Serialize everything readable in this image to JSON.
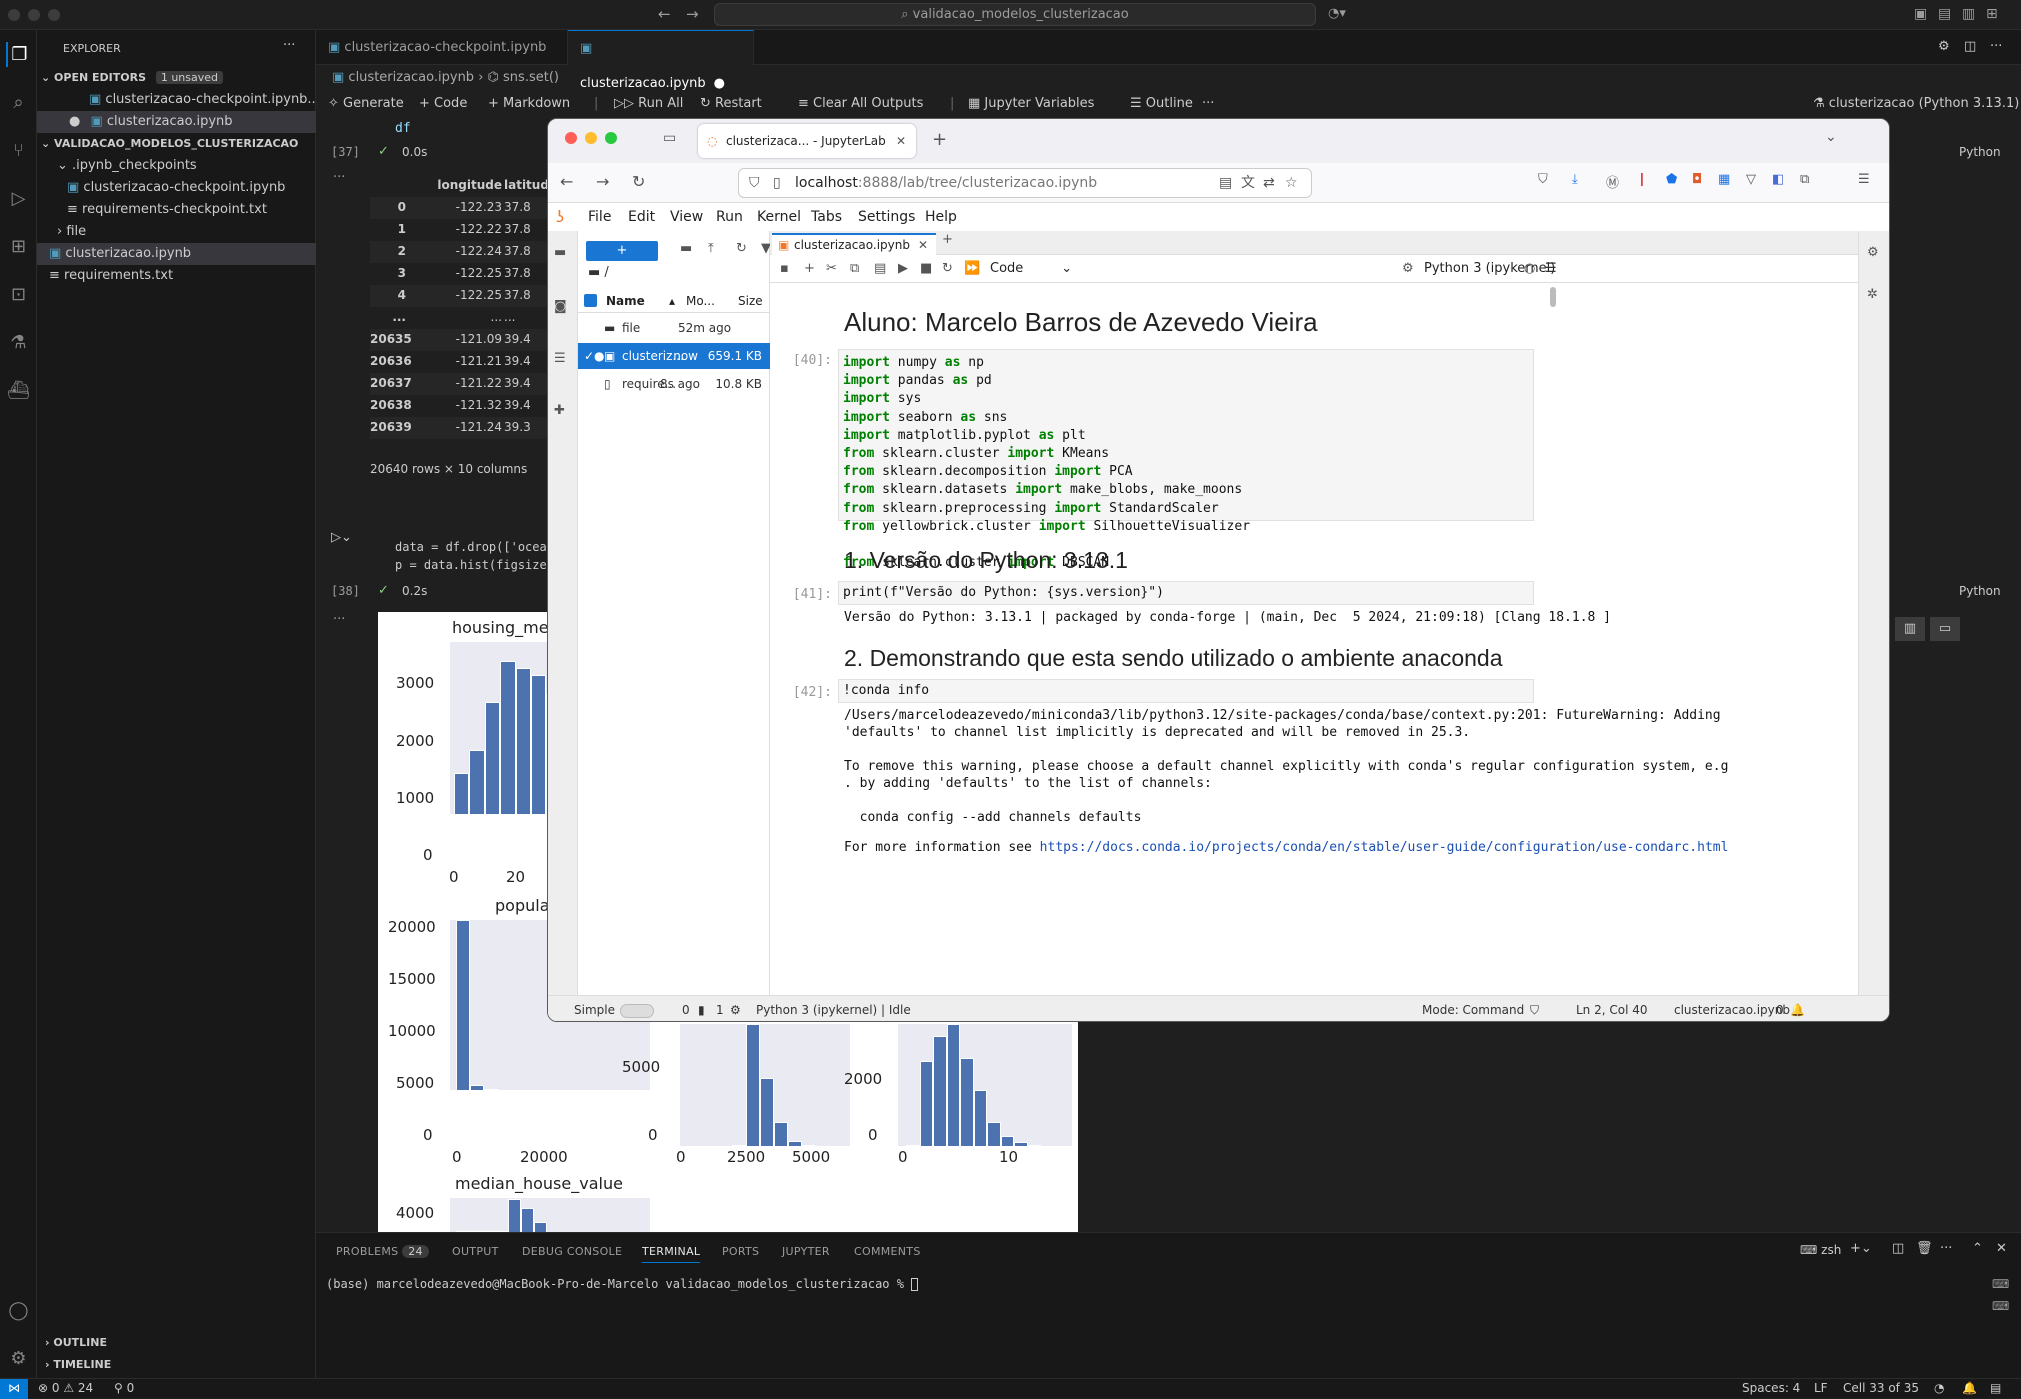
{
  "vscode": {
    "search_text": "validacao_modelos_clusterizacao",
    "explorer_label": "EXPLORER",
    "open_editors_label": "OPEN EDITORS",
    "unsaved_badge": "1 unsaved",
    "open_editors": [
      "clusterizacao-checkpoint.ipynb...",
      "clusterizacao.ipynb"
    ],
    "folder_label": "VALIDACAO_MODELOS_CLUSTERIZACAO",
    "tree": [
      ".ipynb_checkpoints",
      "clusterizacao-checkpoint.ipynb",
      "requirements-checkpoint.txt",
      "file",
      "clusterizacao.ipynb",
      "requirements.txt"
    ],
    "outline_label": "OUTLINE",
    "timeline_label": "TIMELINE",
    "tabs": [
      "clusterizacao-checkpoint.ipynb",
      "clusterizacao.ipynb"
    ],
    "breadcrumb": [
      "clusterizacao.ipynb",
      "sns.set()"
    ],
    "toolbar": [
      "Generate",
      "Code",
      "Markdown",
      "Run All",
      "Restart",
      "Clear All Outputs",
      "Jupyter Variables",
      "Outline"
    ],
    "kernel": "clusterizacao (Python 3.13.1)",
    "cell37": {
      "code": "df",
      "prompt": "[37]",
      "time": "0.0s",
      "lang": "Python"
    },
    "df_headers": [
      "longitude",
      "latitud"
    ],
    "df_rows": [
      [
        "0",
        "-122.23",
        "37.8"
      ],
      [
        "1",
        "-122.22",
        "37.8"
      ],
      [
        "2",
        "-122.24",
        "37.8"
      ],
      [
        "3",
        "-122.25",
        "37.8"
      ],
      [
        "4",
        "-122.25",
        "37.8"
      ],
      [
        "...",
        "...",
        "..."
      ],
      [
        "20635",
        "-121.09",
        "39.4"
      ],
      [
        "20636",
        "-121.21",
        "39.4"
      ],
      [
        "20637",
        "-121.22",
        "39.4"
      ],
      [
        "20638",
        "-121.32",
        "39.4"
      ],
      [
        "20639",
        "-121.24",
        "39.3"
      ]
    ],
    "df_shape": "20640 rows × 10 columns",
    "cell38": {
      "line1": "data = df.drop(['ocea",
      "line2": "p = data.hist(figsize",
      "prompt": "[38]",
      "time": "0.2s",
      "lang": "Python"
    },
    "panel_tabs": [
      "PROBLEMS",
      "OUTPUT",
      "DEBUG CONSOLE",
      "TERMINAL",
      "PORTS",
      "JUPYTER",
      "COMMENTS"
    ],
    "problems_count": "24",
    "terminal_shell": "zsh",
    "terminal_line": "(base) marcelodeazevedo@MacBook-Pro-de-Marcelo validacao_modelos_clusterizacao %",
    "status": {
      "errors": "0",
      "warnings": "24",
      "ports": "0",
      "spaces": "Spaces: 4",
      "eol": "LF",
      "cell": "Cell 33 of 35"
    }
  },
  "plots": {
    "titles": [
      "housing_me",
      "popula",
      "median_house_value"
    ],
    "p1_yticks": [
      "3000",
      "2000",
      "1000",
      "0"
    ],
    "p1_xticks": [
      "0",
      "20"
    ],
    "p2_yticks": [
      "20000",
      "15000",
      "10000",
      "5000",
      "0"
    ],
    "p2_xticks": [
      "0",
      "20000"
    ],
    "p3_yticks": [
      "5000",
      "0"
    ],
    "p3_xticks": [
      "0",
      "2500",
      "5000"
    ],
    "p4_yticks": [
      "2000",
      "0"
    ],
    "p4_xticks": [
      "0",
      "10"
    ],
    "p5_yticks": [
      "4000"
    ]
  },
  "browser": {
    "tab_title": "clusterizaca... - JupyterLab",
    "url_host": "localhost",
    "url_rest": ":8888/lab/tree/clusterizacao.ipynb",
    "menu": [
      "File",
      "Edit",
      "View",
      "Run",
      "Kernel",
      "Tabs",
      "Settings",
      "Help"
    ],
    "fb_path": "/",
    "fb_headers": [
      "Name",
      "Mo...",
      "Size"
    ],
    "fb_rows": [
      {
        "name": "file",
        "mod": "52m ago",
        "size": ""
      },
      {
        "name": "clusteriz...",
        "mod": "now",
        "size": "659.1 KB"
      },
      {
        "name": "require...",
        "mod": "8s ago",
        "size": "10.8 KB"
      }
    ],
    "nb_tab": "clusterizacao.ipynb",
    "cell_type": "Code",
    "kernel": "Python 3 (ipykernel)",
    "title": "Aluno: Marcelo Barros de Azevedo Vieira",
    "p40": "[40]:",
    "imports": [
      [
        "import",
        " numpy ",
        "as",
        " np"
      ],
      [
        "import",
        " pandas ",
        "as",
        " pd"
      ],
      [
        "import",
        " sys",
        "",
        ""
      ],
      [
        "import",
        " seaborn ",
        "as",
        " sns"
      ],
      [
        "import",
        " matplotlib.pyplot ",
        "as",
        " plt"
      ],
      [
        "from",
        " sklearn.cluster ",
        "import",
        " KMeans"
      ],
      [
        "from",
        " sklearn.decomposition ",
        "import",
        " PCA"
      ],
      [
        "from",
        " sklearn.datasets ",
        "import",
        " make_blobs, make_moons"
      ],
      [
        "from",
        " sklearn.preprocessing ",
        "import",
        " StandardScaler"
      ],
      [
        "from",
        " yellowbrick.cluster ",
        "import",
        " SilhouetteVisualizer"
      ],
      [
        "",
        "",
        "",
        ""
      ],
      [
        "from",
        " sklearn.cluster ",
        "import",
        " DBSCAN"
      ]
    ],
    "h_version": "1. Versão do Python: 3.13.1",
    "p41": "[41]:",
    "print_code": "print(f\"Versão do Python: {sys.version}\")",
    "print_out": "Versão do Python: 3.13.1 | packaged by conda-forge | (main, Dec  5 2024, 21:09:18) [Clang 18.1.8 ]",
    "h_env": "2. Demonstrando que esta sendo utilizado o ambiente anaconda",
    "p42": "[42]:",
    "conda_code": "!conda info",
    "conda_out": [
      "/Users/marcelodeazevedo/miniconda3/lib/python3.12/site-packages/conda/base/context.py:201: FutureWarning: Adding",
      "'defaults' to channel list implicitly is deprecated and will be removed in 25.3.",
      "",
      "To remove this warning, please choose a default channel explicitly with conda's regular configuration system, e.g",
      ". by adding 'defaults' to the list of channels:",
      "",
      "  conda config --add channels defaults",
      ""
    ],
    "conda_more": "For more information see ",
    "conda_link": "https://docs.conda.io/projects/conda/en/stable/user-guide/configuration/use-condarc.html",
    "status": {
      "mode_label": "Simple",
      "count0": "0",
      "count1": "1",
      "kernel": "Python 3 (ipykernel) | Idle",
      "mode": "Mode: Command",
      "pos": "Ln 2, Col 40",
      "file": "clusterizacao.ipynb",
      "notif": "0"
    }
  }
}
